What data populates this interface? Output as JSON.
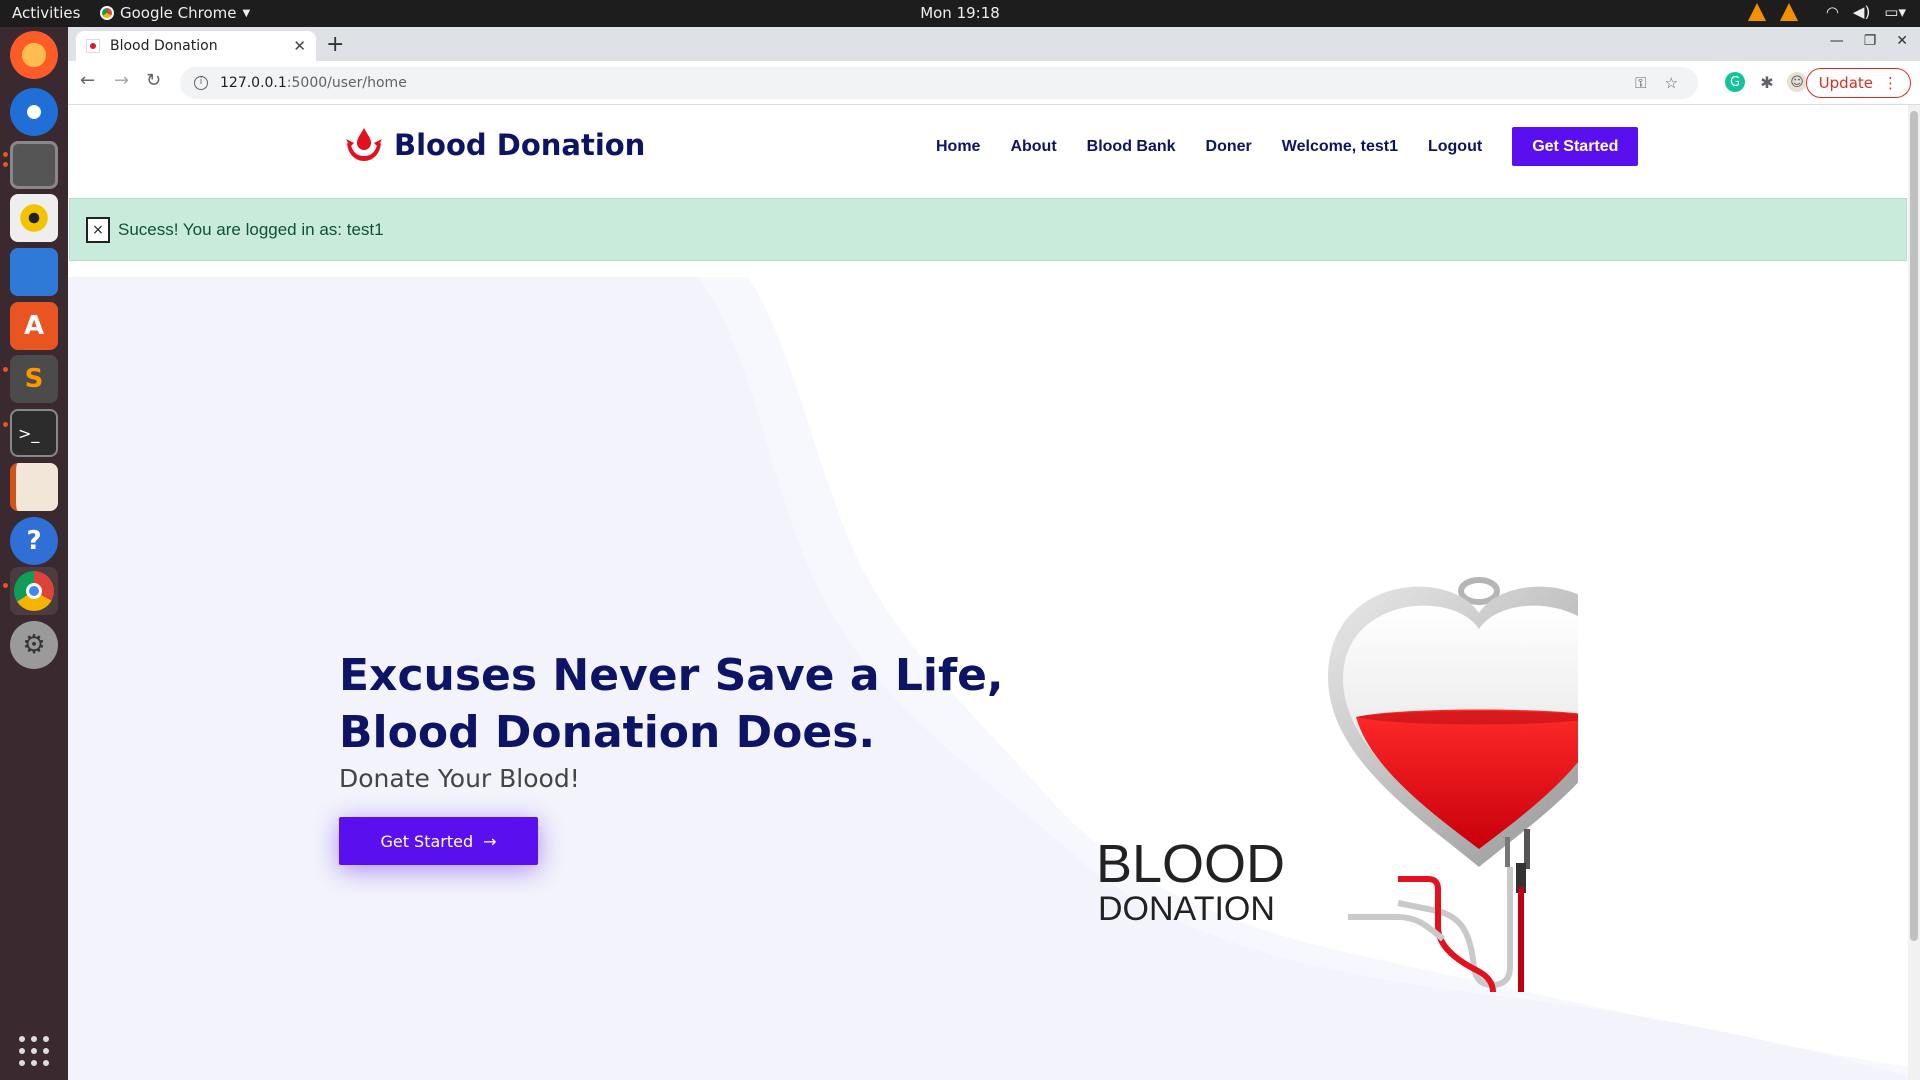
{
  "system": {
    "activities": "Activities",
    "app_name": "Google Chrome",
    "clock": "Mon 19:18"
  },
  "browser": {
    "tab_title": "Blood Donation",
    "url_host": "127.0.0.1",
    "url_path": ":5000/user/home",
    "update_label": "Update"
  },
  "site": {
    "brand": "Blood Donation",
    "nav": {
      "home": "Home",
      "about": "About",
      "blood_bank": "Blood Bank",
      "doner": "Doner",
      "welcome": "Welcome, test1",
      "logout": "Logout",
      "cta": "Get Started"
    },
    "alert": {
      "close": "×",
      "message": "Sucess! You are logged in as: test1"
    },
    "hero": {
      "title_line1": "Excuses Never Save a Life,",
      "title_line2": "Blood Donation Does.",
      "subtitle": "Donate Your Blood!",
      "button": "Get Started",
      "button_arrow": "→"
    },
    "illustration": {
      "word1": "BLOOD",
      "word2": "DONATION"
    }
  },
  "colors": {
    "brand_navy": "#0d1466",
    "accent_purple": "#5a0fee",
    "alert_bg": "#c9ebdc",
    "blood_red": "#e3101e"
  }
}
